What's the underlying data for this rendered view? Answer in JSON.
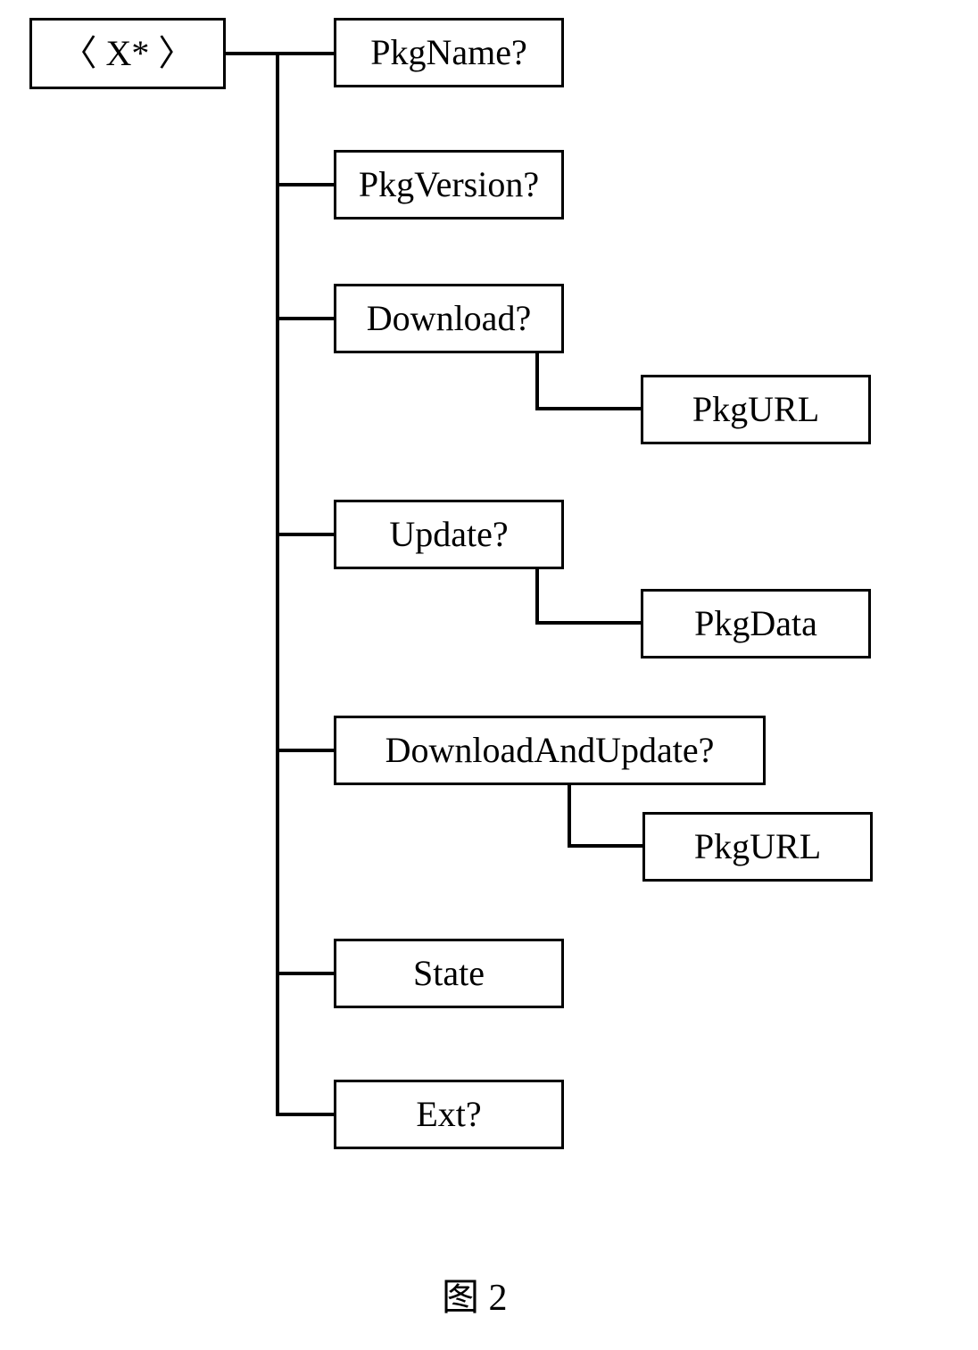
{
  "root": {
    "label": "〈 X* 〉"
  },
  "nodes": {
    "pkgName": {
      "label": "PkgName?"
    },
    "pkgVersion": {
      "label": "PkgVersion?"
    },
    "download": {
      "label": "Download?"
    },
    "downloadChild": {
      "label": "PkgURL"
    },
    "update": {
      "label": "Update?"
    },
    "updateChild": {
      "label": "PkgData"
    },
    "dau": {
      "label": "DownloadAndUpdate?"
    },
    "dauChild": {
      "label": "PkgURL"
    },
    "state": {
      "label": "State"
    },
    "ext": {
      "label": "Ext?"
    }
  },
  "caption": "图 2"
}
